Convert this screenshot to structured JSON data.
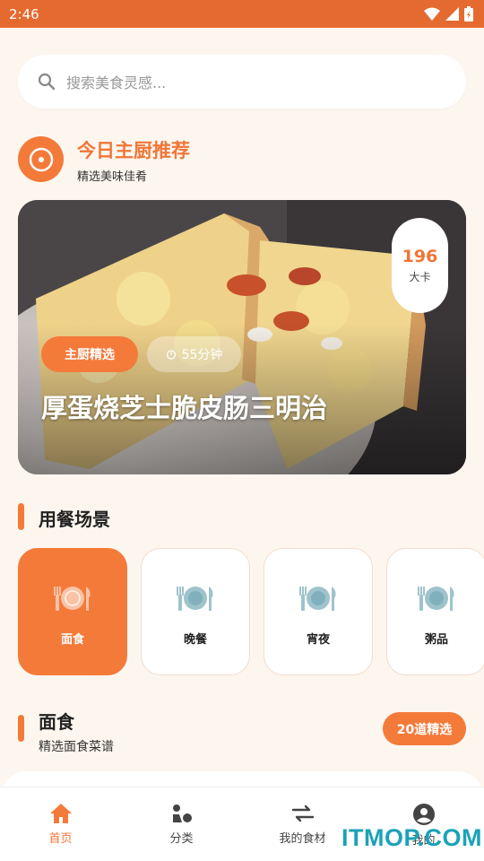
{
  "status_bar": {
    "time": "2:46"
  },
  "search": {
    "placeholder": "搜索美食灵感..."
  },
  "chef_pick": {
    "title": "今日主厨推荐",
    "subtitle": "精选美味佳肴",
    "calories_value": "196",
    "calories_unit": "大卡",
    "tag_label": "主厨精选",
    "time_label": "55分钟",
    "dish_name": "厚蛋烧芝士脆皮肠三明治"
  },
  "scenes": {
    "title": "用餐场景",
    "items": [
      {
        "label": "面食",
        "active": true
      },
      {
        "label": "晚餐",
        "active": false
      },
      {
        "label": "宵夜",
        "active": false
      },
      {
        "label": "粥品",
        "active": false
      }
    ]
  },
  "noodles": {
    "title": "面食",
    "subtitle": "精选面食菜谱",
    "count_badge": "20道精选"
  },
  "tabbar": {
    "items": [
      {
        "label": "首页",
        "icon": "home-icon",
        "active": true
      },
      {
        "label": "分类",
        "icon": "category-icon",
        "active": false
      },
      {
        "label": "我的食材",
        "icon": "swap-icon",
        "active": false
      },
      {
        "label": "我的",
        "icon": "profile-icon",
        "active": false
      }
    ]
  },
  "watermark": "ITMOP.COM",
  "colors": {
    "accent": "#f47a3a",
    "status_bar": "#e56a30",
    "background": "#fdf6ef"
  }
}
